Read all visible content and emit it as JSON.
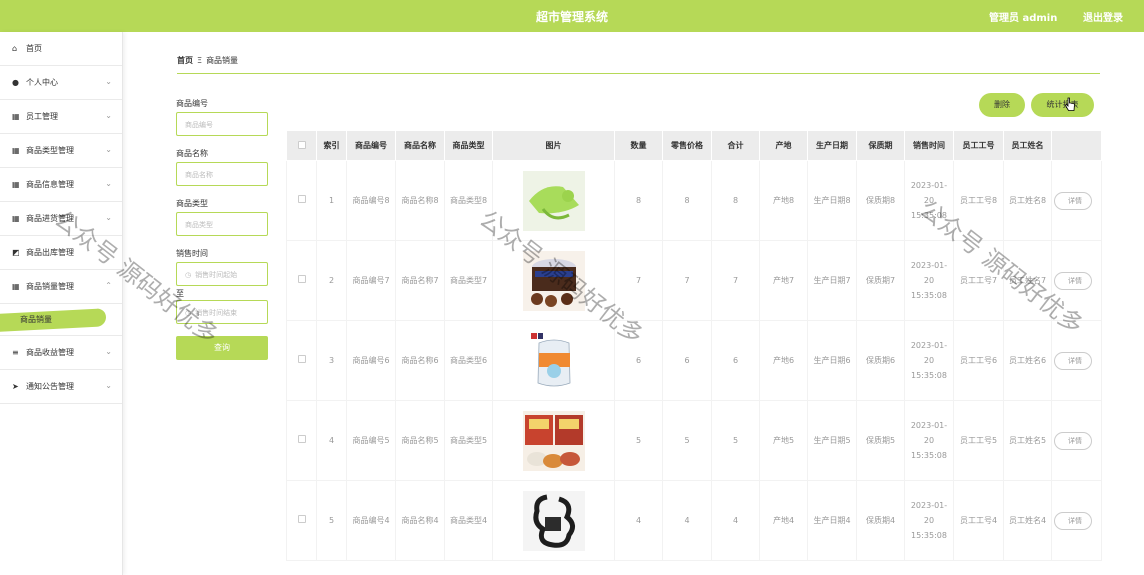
{
  "topbar": {
    "title": "超市管理系统",
    "admin": "管理员 admin",
    "logout": "退出登录"
  },
  "sidebar": {
    "items": [
      {
        "label": "首页",
        "icon": "home-icon"
      },
      {
        "label": "个人中心",
        "icon": "user-icon"
      },
      {
        "label": "员工管理",
        "icon": "grid-icon"
      },
      {
        "label": "商品类型管理",
        "icon": "grid-icon"
      },
      {
        "label": "商品信息管理",
        "icon": "grid-icon"
      },
      {
        "label": "商品进货管理",
        "icon": "grid-icon"
      },
      {
        "label": "商品出库管理",
        "icon": "chart-icon"
      },
      {
        "label": "商品销量管理",
        "icon": "grid-icon"
      },
      {
        "label": "商品收益管理",
        "icon": "list-icon"
      },
      {
        "label": "通知公告管理",
        "icon": "send-icon"
      }
    ],
    "active_sub": "商品销量"
  },
  "breadcrumb": {
    "home": "首页",
    "sep": "Ξ",
    "current": "商品销量"
  },
  "filter": {
    "code_label": "商品编号",
    "code_placeholder": "商品编号",
    "name_label": "商品名称",
    "name_placeholder": "商品名称",
    "type_label": "商品类型",
    "type_placeholder": "商品类型",
    "time_label": "销售时间",
    "start_placeholder": "销售时间起始",
    "to_label": "至",
    "end_placeholder": "销售时间结束",
    "query": "查询"
  },
  "actions": {
    "delete": "删除",
    "stats": "统计报表"
  },
  "table": {
    "headers": [
      "",
      "索引",
      "商品编号",
      "商品名称",
      "商品类型",
      "图片",
      "数量",
      "零售价格",
      "合计",
      "产地",
      "生产日期",
      "保质期",
      "销售时间",
      "员工工号",
      "员工姓名",
      ""
    ],
    "detail": "详情",
    "rows": [
      {
        "index": "1",
        "code": "商品编号8",
        "name": "商品名称8",
        "type": "商品类型8",
        "qty": "8",
        "price": "8",
        "total": "8",
        "origin": "产地8",
        "prod_date": "生产日期8",
        "shelf": "保质期8",
        "sale_time": "2023-01-20 15:35:08",
        "emp_no": "员工工号8",
        "emp_name": "员工姓名8"
      },
      {
        "index": "2",
        "code": "商品编号7",
        "name": "商品名称7",
        "type": "商品类型7",
        "qty": "7",
        "price": "7",
        "total": "7",
        "origin": "产地7",
        "prod_date": "生产日期7",
        "shelf": "保质期7",
        "sale_time": "2023-01-20 15:35:08",
        "emp_no": "员工工号7",
        "emp_name": "员工姓名7"
      },
      {
        "index": "3",
        "code": "商品编号6",
        "name": "商品名称6",
        "type": "商品类型6",
        "qty": "6",
        "price": "6",
        "total": "6",
        "origin": "产地6",
        "prod_date": "生产日期6",
        "shelf": "保质期6",
        "sale_time": "2023-01-20 15:35:08",
        "emp_no": "员工工号6",
        "emp_name": "员工姓名6"
      },
      {
        "index": "4",
        "code": "商品编号5",
        "name": "商品名称5",
        "type": "商品类型5",
        "qty": "5",
        "price": "5",
        "total": "5",
        "origin": "产地5",
        "prod_date": "生产日期5",
        "shelf": "保质期5",
        "sale_time": "2023-01-20 15:35:08",
        "emp_no": "员工工号5",
        "emp_name": "员工姓名5"
      },
      {
        "index": "5",
        "code": "商品编号4",
        "name": "商品名称4",
        "type": "商品类型4",
        "qty": "4",
        "price": "4",
        "total": "4",
        "origin": "产地4",
        "prod_date": "生产日期4",
        "shelf": "保质期4",
        "sale_time": "2023-01-20 15:35:08",
        "emp_no": "员工工号4",
        "emp_name": "员工姓名4"
      }
    ]
  },
  "watermark": "公众号 源码好优多",
  "colors": {
    "accent": "#b6d957"
  }
}
